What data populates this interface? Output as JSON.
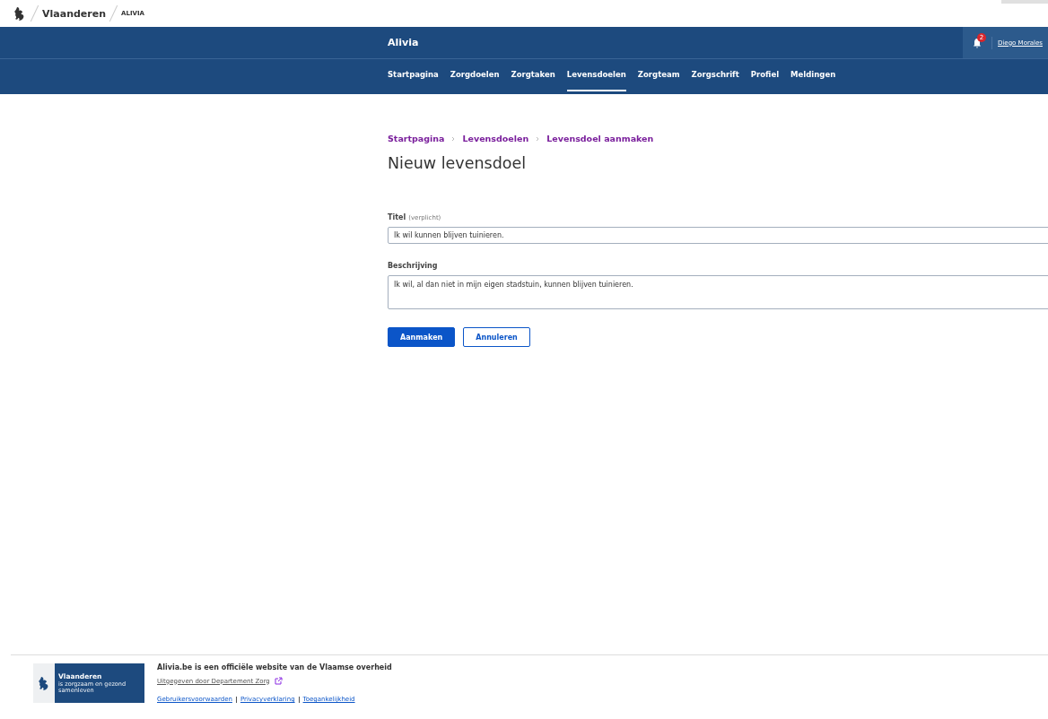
{
  "topbar": {
    "brand": "Vlaanderen",
    "app": "ALIVIA"
  },
  "header": {
    "title": "Alivia",
    "notifications": "2",
    "user": "Diego Morales"
  },
  "nav": [
    {
      "label": "Startpagina",
      "selected": false
    },
    {
      "label": "Zorgdoelen",
      "selected": false
    },
    {
      "label": "Zorgtaken",
      "selected": false
    },
    {
      "label": "Levensdoelen",
      "selected": true
    },
    {
      "label": "Zorgteam",
      "selected": false
    },
    {
      "label": "Zorgschrift",
      "selected": false
    },
    {
      "label": "Profiel",
      "selected": false
    },
    {
      "label": "Meldingen",
      "selected": false
    }
  ],
  "breadcrumb": [
    "Startpagina",
    "Levensdoelen",
    "Levensdoel aanmaken"
  ],
  "heading": "Nieuw levensdoel",
  "form": {
    "fields": [
      {
        "kind": "input",
        "label": "Titel",
        "hint": "(verplicht)",
        "value": "Ik wil kunnen blijven tuinieren."
      },
      {
        "kind": "textarea",
        "label": "Beschrijving",
        "value": "Ik wil, al dan niet in mijn eigen stadstuin, kunnen blijven tuinieren."
      }
    ],
    "buttons": [
      {
        "label": "Aanmaken",
        "kind": "primary"
      },
      {
        "label": "Annuleren",
        "kind": "secondary"
      }
    ]
  },
  "footer": {
    "logo": {
      "name": "Vlaanderen",
      "tagline": "is zorgzaam en gezond samenleven"
    },
    "statement": "Alivia.be is een officiële website van de Vlaamse overheid",
    "publisher": "Uitgegeven door Departement Zorg",
    "links": [
      "Gebruikersvoorwaarden",
      "Privacyverklaring",
      "Toegankelijkheid"
    ]
  }
}
